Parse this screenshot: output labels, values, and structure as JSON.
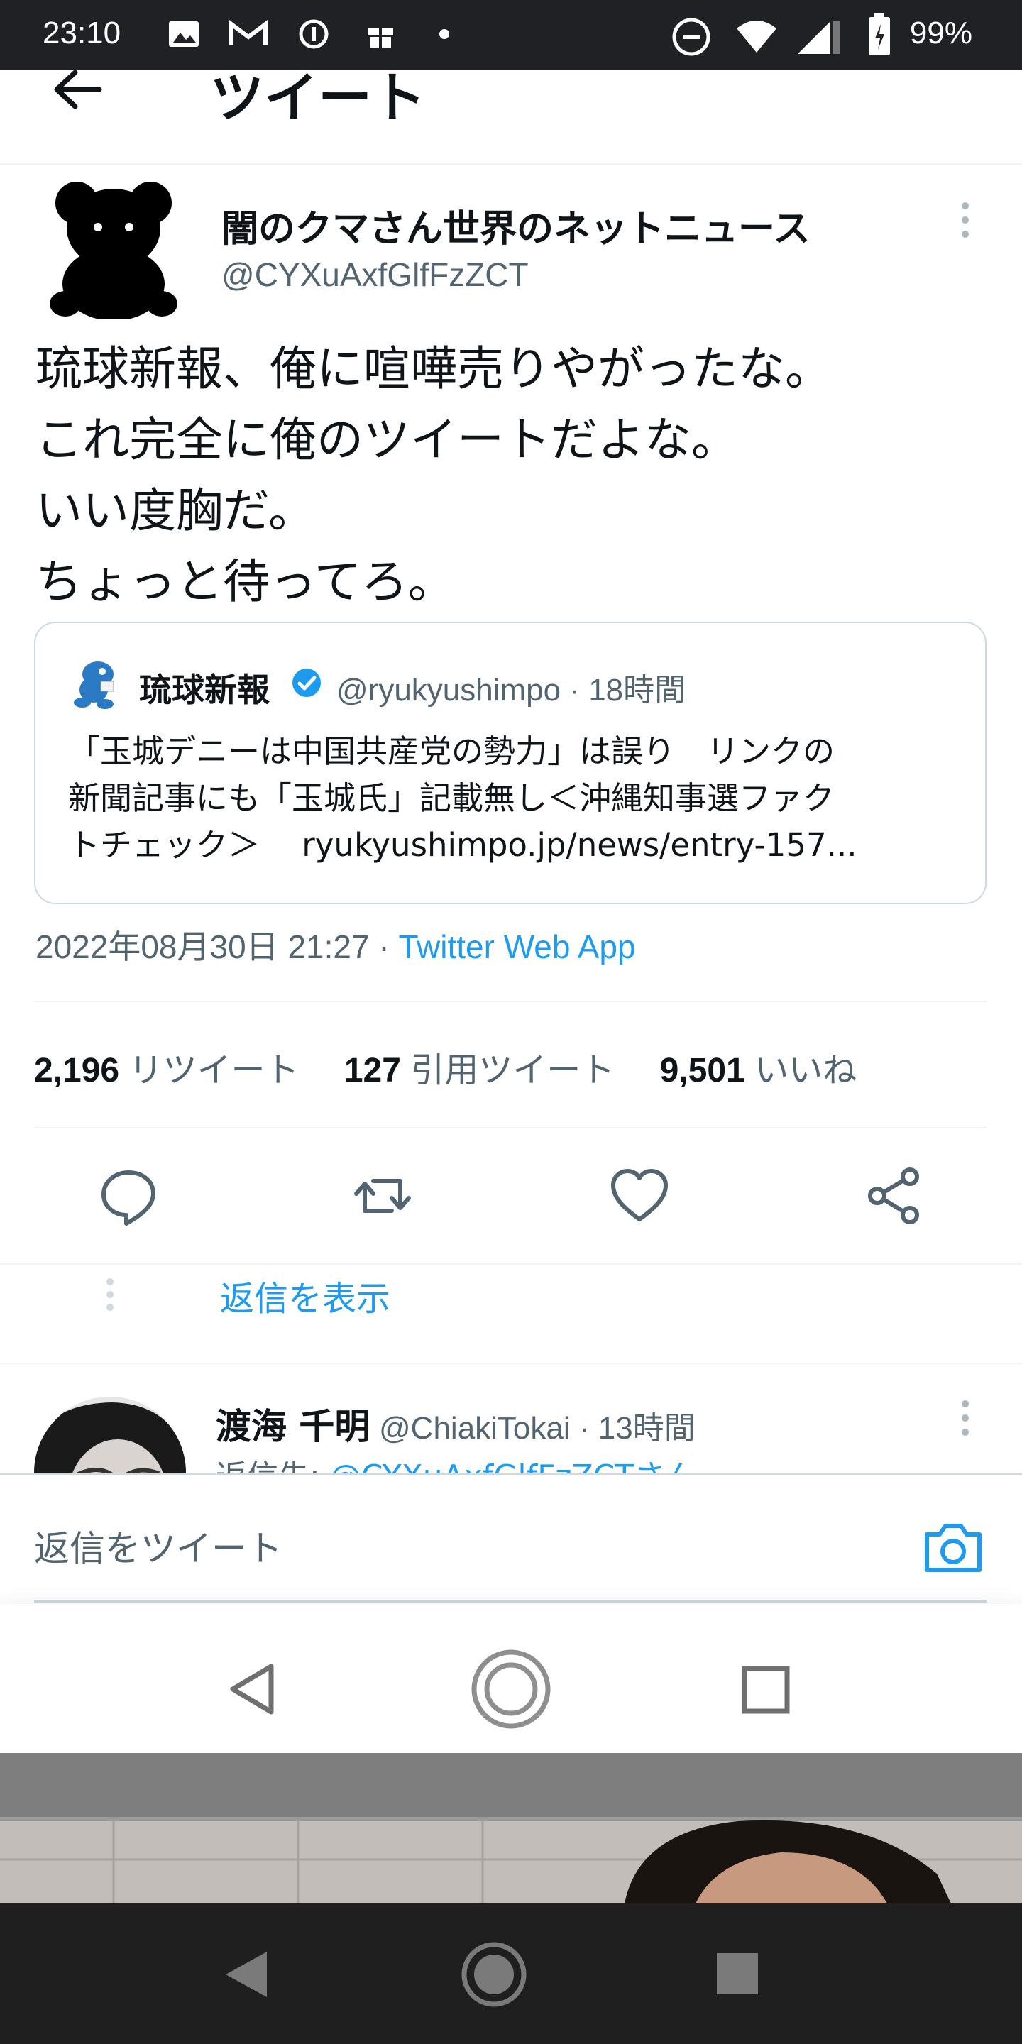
{
  "status_bar": {
    "time": "23:10",
    "battery": "99%"
  },
  "header": {
    "title": "ツイート"
  },
  "tweet": {
    "display_name": "闇のクマさん世界のネットニュース",
    "handle": "@CYXuAxfGlfFzZCT",
    "text": "琉球新報、俺に喧嘩売りやがったな。\nこれ完全に俺のツイートだよな。\nいい度胸だ。\nちょっと待ってろ。",
    "timestamp": "2022年08月30日 21:27",
    "separator": " · ",
    "source_app": "Twitter Web App"
  },
  "quote": {
    "name": "琉球新報",
    "handle": "@ryukyushimpo",
    "time": " · 18時間",
    "text": "「玉城デニーは中国共産党の勢力」は誤り　リンクの\n新聞記事にも「玉城氏」記載無し＜沖縄知事選ファク\nトチェック＞　 ryukyushimpo.jp/news/entry-157..."
  },
  "stats": {
    "retweets": {
      "count": "2,196",
      "label": "リツイート"
    },
    "quotes": {
      "count": "127",
      "label": "引用ツイート"
    },
    "likes": {
      "count": "9,501",
      "label": "いいね"
    }
  },
  "show_replies": "返信を表示",
  "reply": {
    "name": "渡海 千明",
    "handle": "@ChiakiTokai",
    "time": " · 13時間",
    "reply_to_prefix": "返信先: ",
    "reply_to_mention": "@CYXuAxfGlfFzZCTさん"
  },
  "compose": {
    "placeholder": "返信をツイート"
  },
  "colors": {
    "accent": "#1d9bf0",
    "muted": "#536471",
    "status_bar": "#202124"
  }
}
